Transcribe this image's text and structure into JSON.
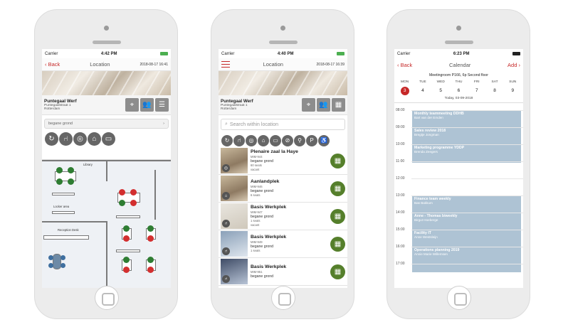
{
  "phone1": {
    "status": {
      "carrier": "Carrier",
      "time": "4:42 PM"
    },
    "nav": {
      "back": "Back",
      "title": "Location",
      "date": "2018-08-17 16:41"
    },
    "location": {
      "name": "Puntegaal Werf",
      "street": "Puntegaalstraat 1",
      "city": "Rotterdam"
    },
    "floor": "begane grond",
    "plan_labels": {
      "library": "Library",
      "locker": "Locker area",
      "reception": "Reception Desk"
    }
  },
  "phone2": {
    "status": {
      "carrier": "Carrier",
      "time": "4:40 PM"
    },
    "nav": {
      "title": "Location",
      "date": "2018-08-17 16:39"
    },
    "location": {
      "name": "Puntegaal Werf",
      "street": "Puntegaalstraat 1",
      "city": "Rotterdam"
    },
    "search_placeholder": "Search within location",
    "rooms": [
      {
        "name": "Plenaire zaal la Haye",
        "code": "MIM-944",
        "floor": "begane grond",
        "seats": "60 seats",
        "status": "vacant"
      },
      {
        "name": "Aanlandplek",
        "code": "MIM-946",
        "floor": "begane grond",
        "seats": "6 seats",
        "status": ""
      },
      {
        "name": "Basis Werkplek",
        "code": "MIM-947",
        "floor": "begane grond",
        "seats": "1 seats",
        "status": "vacant"
      },
      {
        "name": "Basis Werkplek",
        "code": "MIM-949",
        "floor": "begane grond",
        "seats": "1 seats",
        "status": ""
      },
      {
        "name": "Basis Werkplek",
        "code": "MIM-951",
        "floor": "begane grond",
        "seats": "",
        "status": ""
      }
    ]
  },
  "phone3": {
    "status": {
      "carrier": "Carrier",
      "time": "6:23 PM"
    },
    "nav": {
      "back": "Back",
      "title": "Calendar",
      "add": "Add"
    },
    "room_line": "Meetingroom P166, 6p Second floor",
    "weekdays": [
      "MON",
      "TUE",
      "WED",
      "THU",
      "FRI",
      "SAT",
      "SUN"
    ],
    "days": [
      "3",
      "4",
      "5",
      "6",
      "7",
      "8",
      "9"
    ],
    "today_line": "Today, 03-09-2018",
    "hours": [
      "08:00",
      "09:00",
      "10:00",
      "11:00",
      "12:00",
      "13:00",
      "14:00",
      "15:00",
      "16:00",
      "17:00"
    ],
    "events": [
      {
        "title": "Monthly teammeeting DDHB",
        "person": "Bart van der Emden"
      },
      {
        "title": "Sales review 2018",
        "person": "Bregtje Jongman"
      },
      {
        "title": "Marketing programme YDDP",
        "person": "Brenda Zeegers"
      },
      {
        "title": "Finance team weekly",
        "person": "Bas Bakkum"
      },
      {
        "title": "Anne - Thomas biweekly",
        "person": "Birgut Hoeberge"
      },
      {
        "title": "Facility IT",
        "person": "Anne Westsleijn"
      },
      {
        "title": "Operations planning 2019",
        "person": "Annie Marie Willemsen"
      }
    ]
  }
}
